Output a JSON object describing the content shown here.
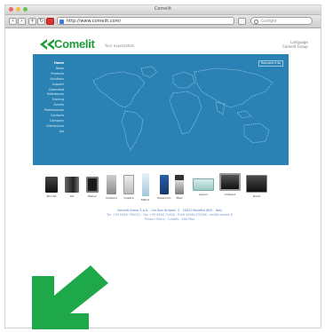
{
  "window": {
    "title": "Comelit",
    "traffic_lights": [
      "#ee6a5f",
      "#f5be4f",
      "#62c655"
    ]
  },
  "toolbar": {
    "url": "http://www.comelit.com/",
    "search_placeholder": "Google",
    "button_icons": [
      "back-icon",
      "forward-icon",
      "add-icon",
      "reload-icon",
      "bookmark-icon",
      "rss-icon"
    ]
  },
  "header": {
    "logo_text": "Comelit",
    "logo_color": "#1d9a3a",
    "tagline": "Your expectation",
    "links": [
      "Language",
      "Comelit Group"
    ]
  },
  "hero": {
    "background": "#2a82b4",
    "button_label": "Request Info",
    "menu": [
      "Home",
      "News",
      "Products",
      "Solutions",
      "Support",
      "Download",
      "References",
      "Training",
      "Events",
      "Professionals",
      "Contacts",
      "Company",
      "Distributors",
      "Job"
    ]
  },
  "products": [
    {
      "label": "Mini Kit"
    },
    {
      "label": "Kit"
    },
    {
      "label": "Planux"
    },
    {
      "label": "Simbiosi"
    },
    {
      "label": "Quadra"
    },
    {
      "label": "Matrix"
    },
    {
      "label": "Powercom"
    },
    {
      "label": "Maxi"
    },
    {
      "label": "Lavoro"
    },
    {
      "label": "Ambient"
    },
    {
      "label": "Quick"
    }
  ],
  "footer": {
    "lines": [
      "Comelit Group S.p.A. - Via Don Arrigoni, 5 - 24020 Rovetta (BG) - Italy",
      "Tel. +39 0346 750011 - Fax +39 0346 71436 - P.IVA 00961470166 - info@comelit.it",
      "Privacy Policy - Credits - Site Map"
    ]
  },
  "overlay": {
    "arrow_icon": "arrow-down-left-icon",
    "arrow_color": "#1ea84a"
  }
}
